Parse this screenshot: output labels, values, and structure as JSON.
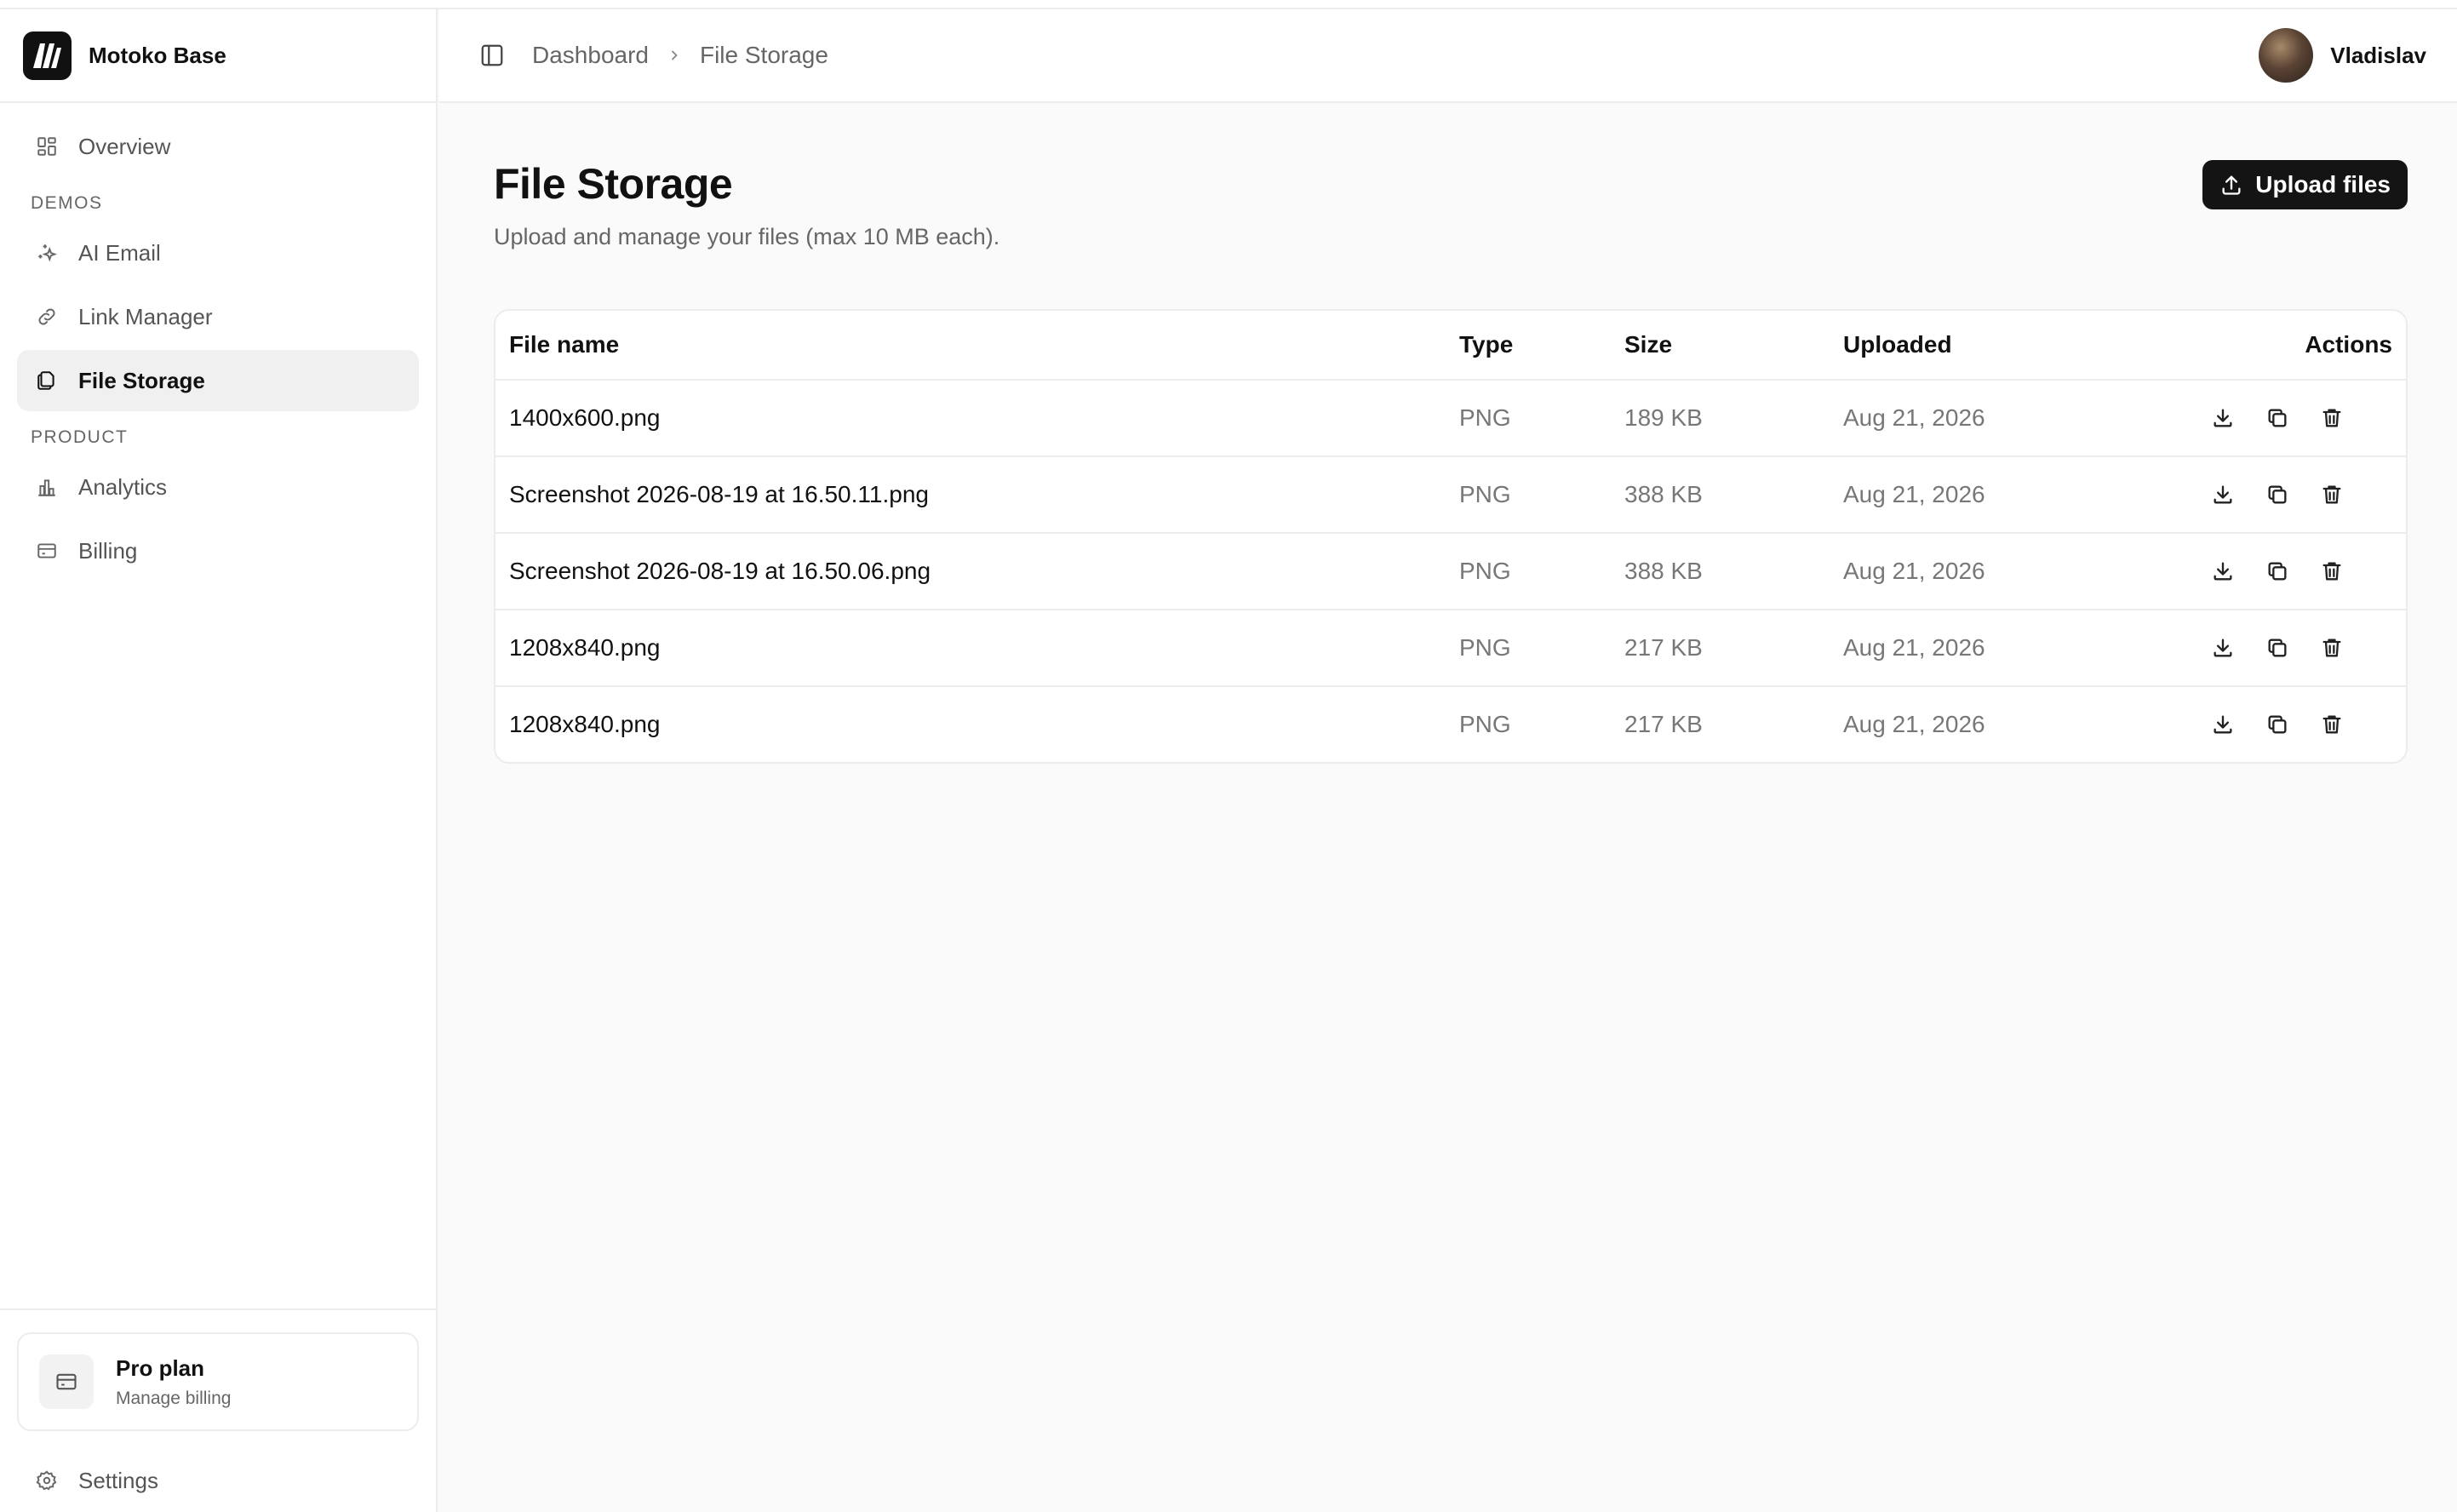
{
  "app": {
    "name": "Motoko Base"
  },
  "sidebar": {
    "overview": {
      "label": "Overview",
      "icon": "grid-icon"
    },
    "sections": [
      {
        "title": "DEMOS",
        "items": [
          {
            "label": "AI Email",
            "icon": "sparkles-icon"
          },
          {
            "label": "Link Manager",
            "icon": "link-icon"
          },
          {
            "label": "File Storage",
            "icon": "files-icon",
            "active": true
          }
        ]
      },
      {
        "title": "PRODUCT",
        "items": [
          {
            "label": "Analytics",
            "icon": "bar-chart-icon"
          },
          {
            "label": "Billing",
            "icon": "credit-card-icon"
          }
        ]
      }
    ],
    "plan": {
      "title": "Pro plan",
      "subtitle": "Manage billing",
      "icon": "credit-card-icon"
    },
    "settings": {
      "label": "Settings",
      "icon": "gear-icon"
    }
  },
  "header": {
    "breadcrumb": [
      "Dashboard",
      "File Storage"
    ],
    "user_name": "Vladislav"
  },
  "page": {
    "title": "File Storage",
    "subtitle": "Upload and manage your files (max 10 MB each).",
    "upload_label": "Upload files"
  },
  "table": {
    "columns": [
      "File name",
      "Type",
      "Size",
      "Uploaded",
      "Actions"
    ],
    "rows": [
      {
        "name": "1400x600.png",
        "type": "PNG",
        "size": "189 KB",
        "uploaded": "Aug 21, 2026"
      },
      {
        "name": "Screenshot 2026-08-19 at 16.50.11.png",
        "type": "PNG",
        "size": "388 KB",
        "uploaded": "Aug 21, 2026"
      },
      {
        "name": "Screenshot 2026-08-19 at 16.50.06.png",
        "type": "PNG",
        "size": "388 KB",
        "uploaded": "Aug 21, 2026"
      },
      {
        "name": "1208x840.png",
        "type": "PNG",
        "size": "217 KB",
        "uploaded": "Aug 21, 2026"
      },
      {
        "name": "1208x840.png",
        "type": "PNG",
        "size": "217 KB",
        "uploaded": "Aug 21, 2026"
      }
    ],
    "row_actions": [
      "download-icon",
      "copy-icon",
      "trash-icon"
    ]
  }
}
